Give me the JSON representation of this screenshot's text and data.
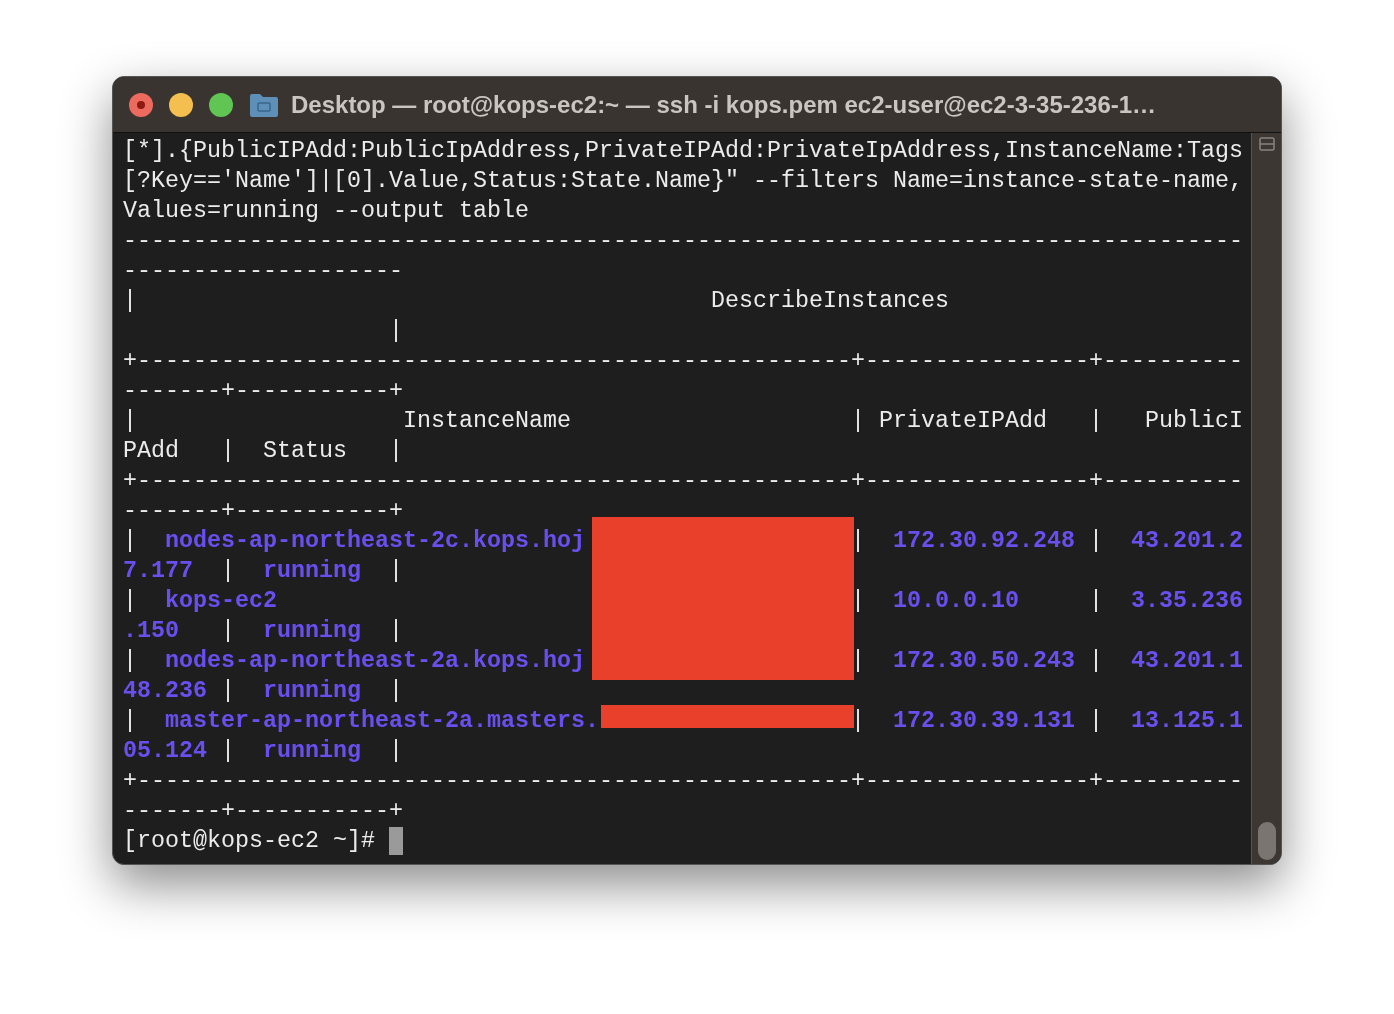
{
  "window": {
    "title": "Desktop — root@kops-ec2:~ — ssh -i kops.pem ec2-user@ec2-3-35-236-1…"
  },
  "terminal": {
    "lines": [
      {
        "segments": [
          {
            "kind": "plain",
            "text": "[*].{PublicIPAdd:PublicIpAddress,PrivateIPAdd:PrivateIpAddress,InstanceName:Tags"
          }
        ]
      },
      {
        "segments": [
          {
            "kind": "plain",
            "text": "[?Key=='Name']|[0].Value,Status:State.Name}\" --filters Name=instance-state-name,"
          }
        ]
      },
      {
        "segments": [
          {
            "kind": "plain",
            "text": "Values=running --output table"
          }
        ]
      },
      {
        "segments": [
          {
            "kind": "plain",
            "text": "--------------------------------------------------------------------------------"
          }
        ]
      },
      {
        "segments": [
          {
            "kind": "plain",
            "text": "--------------------"
          }
        ]
      },
      {
        "segments": [
          {
            "kind": "plain",
            "text": "|                                         DescribeInstances"
          }
        ]
      },
      {
        "segments": [
          {
            "kind": "plain",
            "text": "                   |"
          }
        ]
      },
      {
        "segments": [
          {
            "kind": "plain",
            "text": "+---------------------------------------------------+----------------+----------"
          }
        ]
      },
      {
        "segments": [
          {
            "kind": "plain",
            "text": "-------+-----------+"
          }
        ]
      },
      {
        "segments": [
          {
            "kind": "plain",
            "text": "|                   InstanceName                    | PrivateIPAdd   |   PublicI"
          }
        ]
      },
      {
        "segments": [
          {
            "kind": "plain",
            "text": "PAdd   |  Status   |"
          }
        ]
      },
      {
        "segments": [
          {
            "kind": "plain",
            "text": "+---------------------------------------------------+----------------+----------"
          }
        ]
      },
      {
        "segments": [
          {
            "kind": "plain",
            "text": "-------+-----------+"
          }
        ]
      },
      {
        "segments": [
          {
            "kind": "plain",
            "text": "|  "
          },
          {
            "kind": "value",
            "text": "nodes-ap-northeast-2c.kops.hoj"
          },
          {
            "kind": "plain",
            "text": "                   |  "
          },
          {
            "kind": "value",
            "text": "172.30.92.248"
          },
          {
            "kind": "plain",
            "text": " |  "
          },
          {
            "kind": "value",
            "text": "43.201.2"
          }
        ]
      },
      {
        "segments": [
          {
            "kind": "value",
            "text": "7.177"
          },
          {
            "kind": "plain",
            "text": "  |  "
          },
          {
            "kind": "value",
            "text": "running"
          },
          {
            "kind": "plain",
            "text": "  |"
          }
        ]
      },
      {
        "segments": [
          {
            "kind": "plain",
            "text": "|  "
          },
          {
            "kind": "value",
            "text": "kops-ec2"
          },
          {
            "kind": "plain",
            "text": "                                         |  "
          },
          {
            "kind": "value",
            "text": "10.0.0.10"
          },
          {
            "kind": "plain",
            "text": "     |  "
          },
          {
            "kind": "value",
            "text": "3.35.236"
          }
        ]
      },
      {
        "segments": [
          {
            "kind": "value",
            "text": ".150"
          },
          {
            "kind": "plain",
            "text": "   |  "
          },
          {
            "kind": "value",
            "text": "running"
          },
          {
            "kind": "plain",
            "text": "  |"
          }
        ]
      },
      {
        "segments": [
          {
            "kind": "plain",
            "text": "|  "
          },
          {
            "kind": "value",
            "text": "nodes-ap-northeast-2a.kops.hoj"
          },
          {
            "kind": "plain",
            "text": "                   |  "
          },
          {
            "kind": "value",
            "text": "172.30.50.243"
          },
          {
            "kind": "plain",
            "text": " |  "
          },
          {
            "kind": "value",
            "text": "43.201.1"
          }
        ]
      },
      {
        "segments": [
          {
            "kind": "value",
            "text": "48.236"
          },
          {
            "kind": "plain",
            "text": " |  "
          },
          {
            "kind": "value",
            "text": "running"
          },
          {
            "kind": "plain",
            "text": "  |"
          }
        ]
      },
      {
        "segments": [
          {
            "kind": "plain",
            "text": "|  "
          },
          {
            "kind": "value",
            "text": "master-ap-northeast-2a.masters."
          },
          {
            "kind": "plain",
            "text": "                  |  "
          },
          {
            "kind": "value",
            "text": "172.30.39.131"
          },
          {
            "kind": "plain",
            "text": " |  "
          },
          {
            "kind": "value",
            "text": "13.125.1"
          }
        ]
      },
      {
        "segments": [
          {
            "kind": "value",
            "text": "05.124"
          },
          {
            "kind": "plain",
            "text": " |  "
          },
          {
            "kind": "value",
            "text": "running"
          },
          {
            "kind": "plain",
            "text": "  |"
          }
        ]
      },
      {
        "segments": [
          {
            "kind": "plain",
            "text": "+---------------------------------------------------+----------------+----------"
          }
        ]
      },
      {
        "segments": [
          {
            "kind": "plain",
            "text": "-------+-----------+"
          }
        ]
      }
    ],
    "prompt": "[root@kops-ec2 ~]#"
  }
}
